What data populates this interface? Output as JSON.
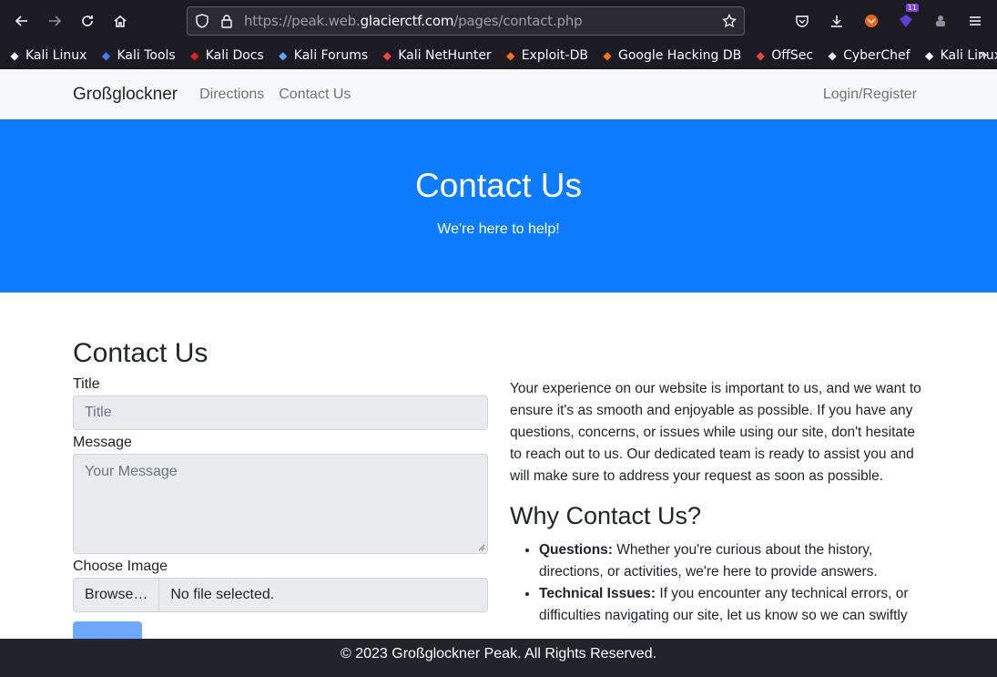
{
  "browser": {
    "url_prefix": "https://peak.web.",
    "url_domain": "glacierctf.com",
    "url_path": "/pages/contact.php",
    "extensions_badge": "11",
    "bookmarks": [
      {
        "label": "Kali Linux",
        "icon": "kali-dragon-icon",
        "color": "#ffffff"
      },
      {
        "label": "Kali Tools",
        "icon": "kali-tools-icon",
        "color": "#3b82f6"
      },
      {
        "label": "Kali Docs",
        "icon": "kali-docs-icon",
        "color": "#dc2626"
      },
      {
        "label": "Kali Forums",
        "icon": "kali-forums-icon",
        "color": "#60a5fa"
      },
      {
        "label": "Kali NetHunter",
        "icon": "nethunter-icon",
        "color": "#ef4444"
      },
      {
        "label": "Exploit-DB",
        "icon": "exploit-db-icon",
        "color": "#f97316"
      },
      {
        "label": "Google Hacking DB",
        "icon": "ghdb-icon",
        "color": "#f97316"
      },
      {
        "label": "OffSec",
        "icon": "offsec-icon",
        "color": "#ef4444"
      },
      {
        "label": "CyberChef",
        "icon": "cyberchef-icon",
        "color": "#e5e7eb"
      },
      {
        "label": "Kali Linux",
        "icon": "kali-dragon-icon",
        "color": "#ffffff"
      }
    ]
  },
  "navbar": {
    "brand": "Großglockner",
    "links": [
      "Directions",
      "Contact Us"
    ],
    "login": "Login/Register"
  },
  "hero": {
    "title": "Contact Us",
    "subtitle": "We're here to help!"
  },
  "form": {
    "heading": "Contact Us",
    "title_label": "Title",
    "title_placeholder": "Title",
    "message_label": "Message",
    "message_placeholder": "Your Message",
    "image_label": "Choose Image",
    "browse_label": "Browse…",
    "file_status": "No file selected."
  },
  "info": {
    "intro": "Your experience on our website is important to us, and we want to ensure it's as smooth and enjoyable as possible. If you have any questions, concerns, or issues while using our site, don't hesitate to reach out to us. Our dedicated team is ready to assist you and will make sure to address your request as soon as possible.",
    "why_heading": "Why Contact Us?",
    "items": [
      {
        "term": "Questions:",
        "text": " Whether you're curious about the history, directions, or activities, we're here to provide answers."
      },
      {
        "term": "Technical Issues:",
        "text": " If you encounter any technical errors, or difficulties navigating our site, let us know so we can swiftly"
      }
    ]
  },
  "footer": {
    "text": "© 2023 Großglockner Peak. All Rights Reserved."
  },
  "colors": {
    "hero": "#0d7cff",
    "footer": "#212529",
    "chrome": "#1c1b22"
  }
}
